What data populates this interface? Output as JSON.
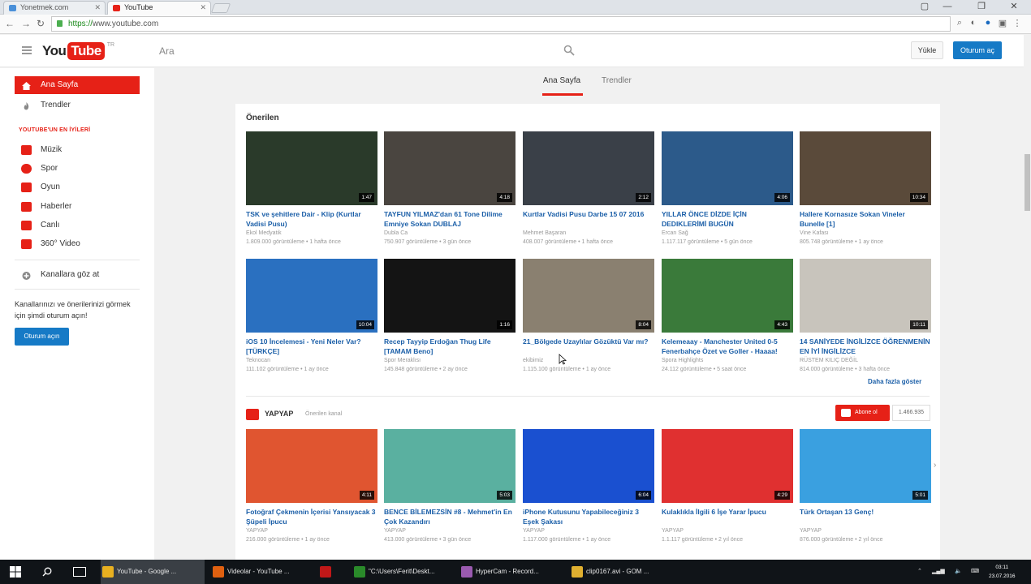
{
  "browser": {
    "tabs": [
      {
        "label": "Yonetmek.com",
        "color": "#4a90d9"
      },
      {
        "label": "YouTube",
        "color": "#e62117"
      }
    ],
    "url_scheme": "https://",
    "url_rest": "www.youtube.com"
  },
  "header": {
    "logo_you": "You",
    "logo_tube": "Tube",
    "logo_region": "TR",
    "search_placeholder": "Ara",
    "upload_label": "Yükle",
    "signin_label": "Oturum aç"
  },
  "sidebar": {
    "top_items": [
      {
        "label": "Ana Sayfa",
        "icon": "home-icon",
        "color": "#ffffff"
      },
      {
        "label": "Trendler",
        "icon": "trending-icon",
        "color": "#888888"
      }
    ],
    "best_heading": "YOUTUBE'UN EN İYİLERİ",
    "best_items": [
      {
        "label": "Müzik",
        "icon": "music-icon",
        "color": "#e62117"
      },
      {
        "label": "Spor",
        "icon": "sports-icon",
        "color": "#e62117"
      },
      {
        "label": "Oyun",
        "icon": "gaming-icon",
        "color": "#e62117"
      },
      {
        "label": "Haberler",
        "icon": "news-icon",
        "color": "#e62117"
      },
      {
        "label": "Canlı",
        "icon": "live-icon",
        "color": "#e62117"
      },
      {
        "label": "360° Video",
        "icon": "360-video-icon",
        "color": "#e62117"
      }
    ],
    "browse_channels": "Kanallara göz at",
    "signin_prompt": "Kanallarınızı ve önerilerinizi görmek için şimdi oturum açın!",
    "signin_button": "Oturum açın"
  },
  "main": {
    "tabs": [
      "Ana Sayfa",
      "Trendler"
    ],
    "recommended_title": "Önerilen",
    "more_link": "Daha fazla göster",
    "recommended": [
      {
        "title": "TSK ve şehitlere Dair - Klip (Kurtlar Vadisi Pusu)",
        "channel": "Ekol Medyatik",
        "meta": "1.809.000 görüntüleme • 1 hafta önce",
        "duration": "1:47",
        "bg": "#2a3a2a"
      },
      {
        "title": "TAYFUN YILMAZ'dan 61 Tone Dilime Emniye Sokan DUBLAJ",
        "channel": "Dubla Ca",
        "meta": "750.907 görüntüleme • 3 gün önce",
        "duration": "4:18",
        "bg": "#4a4540"
      },
      {
        "title": "Kurtlar Vadisi Pusu Darbe 15 07 2016",
        "channel": "Mehmet Başaran",
        "meta": "408.007 görüntüleme • 1 hafta önce",
        "duration": "2:12",
        "bg": "#3a4048"
      },
      {
        "title": "YILLAR ÖNCE DİZDE İÇİN DEDIKLERİMİ BUGÜN",
        "channel": "Ercan Sağ",
        "meta": "1.117.117 görüntüleme • 5 gün önce",
        "duration": "4:06",
        "bg": "#2c5a8a"
      },
      {
        "title": "Hallere Kornasıze Sokan Vineler Bunelle [1]",
        "channel": "Vine Kafası",
        "meta": "805.748 görüntüleme • 1 ay önce",
        "duration": "10:34",
        "bg": "#5a4a3a"
      },
      {
        "title": "iOS 10 İncelemesi - Yeni Neler Var? [TÜRKÇE]",
        "channel": "Teknocan",
        "meta": "111.102 görüntüleme • 1 ay önce",
        "duration": "10:04",
        "bg": "#2a70c0"
      },
      {
        "title": "Recep Tayyip Erdoğan Thug Life [TAMAM Beno]",
        "channel": "Spor Meraklısı",
        "meta": "145.848 görüntüleme • 2 ay önce",
        "duration": "1:16",
        "bg": "#141414"
      },
      {
        "title": "21_Bölgede Uzaylılar Gözüktü Var mı?",
        "channel": "ekibimiz",
        "meta": "1.115.100 görüntüleme • 1 ay önce",
        "duration": "8:04",
        "bg": "#8a8070"
      },
      {
        "title": "Kelemeaay - Manchester United 0-5 Fenerbahçe Özet ve Goller - Haaaa!",
        "channel": "Spora Highlights",
        "meta": "24.112 görüntüleme • 5 saat önce",
        "duration": "4:43",
        "bg": "#3a7a3a"
      },
      {
        "title": "14 SANİYEDE İNGİLİZCE ÖĞRENMENİN EN İYİ İNGİLİZCE",
        "channel": "RÜSTEM KILIÇ DEĞİL",
        "meta": "814.000 görüntüleme • 3 hafta önce",
        "duration": "10:11",
        "bg": "#c8c4bc"
      }
    ],
    "channel": {
      "name": "YAPYAP",
      "subtitle": "Önerilen kanal",
      "subscribe": "Abone ol",
      "subscriber_count": "1.466.935"
    },
    "channel_videos": [
      {
        "title": "Fotoğraf Çekmenin İçerisi Yansıyacak 3 Şüpeli İpucu",
        "channel": "YAPYAP",
        "meta": "216.000 görüntüleme • 1 ay önce",
        "duration": "4:11",
        "bg": "#e05530"
      },
      {
        "title": "BENCE BİLEMEZSİN #8 - Mehmet'in En Çok Kazandırı",
        "channel": "YAPYAP",
        "meta": "413.000 görüntüleme • 3 gün önce",
        "duration": "5:03",
        "bg": "#5ab0a0"
      },
      {
        "title": "iPhone Kutusunu Yapabileceğiniz 3 Eşek Şakası",
        "channel": "YAPYAP",
        "meta": "1.117.000 görüntüleme • 1 ay önce",
        "duration": "6:04",
        "bg": "#1a50d0"
      },
      {
        "title": "Kulaklıkla İlgili 6 İşe Yarar İpucu",
        "channel": "YAPYAP",
        "meta": "1.1.117 görüntüleme • 2 yıl önce",
        "duration": "4:29",
        "bg": "#e03030"
      },
      {
        "title": "Türk Ortaşan 13 Genç!",
        "channel": "YAPYAP",
        "meta": "876.000 görüntüleme • 2 yıl önce",
        "duration": "5:01",
        "bg": "#3aa0e0"
      }
    ]
  },
  "taskbar": {
    "items": [
      {
        "label": "YouTube - Google ...",
        "color": "#e8b020"
      },
      {
        "label": "Videolar - YouTube ...",
        "color": "#e06010"
      },
      {
        "label": "",
        "color": "#c01818"
      },
      {
        "label": "\"C:\\Users\\Ferit\\Deskt...",
        "color": "#2a8a2a"
      },
      {
        "label": "HyperCam - Record...",
        "color": "#9a5ab0"
      },
      {
        "label": "clip0167.avi - GOM ...",
        "color": "#e0b030"
      }
    ],
    "time": "03:11",
    "date": "23.07.2016"
  }
}
